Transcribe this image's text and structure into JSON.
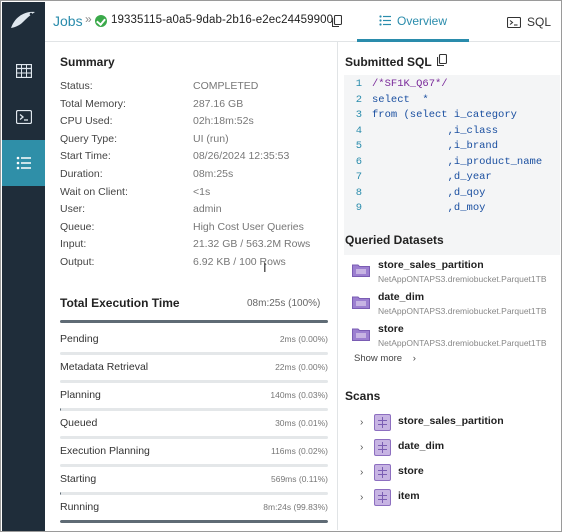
{
  "header": {
    "breadcrumb": "Jobs",
    "separator": "»",
    "job_id": "19335115-a0a5-9dab-2b16-e2ec24459900",
    "tabs": [
      {
        "label": "Overview",
        "icon": "list-icon",
        "active": true
      },
      {
        "label": "SQL",
        "icon": "terminal-icon",
        "active": false
      }
    ],
    "accent_color": "#2a8cac"
  },
  "nav": {
    "items": [
      {
        "icon": "table-icon",
        "active": false
      },
      {
        "icon": "terminal-icon",
        "active": false
      },
      {
        "icon": "list-icon",
        "active": true
      }
    ]
  },
  "summary": {
    "title": "Summary",
    "rows": [
      {
        "key": "Status:",
        "value": "COMPLETED"
      },
      {
        "key": "Total Memory:",
        "value": "287.16 GB"
      },
      {
        "key": "CPU Used:",
        "value": "02h:18m:52s"
      },
      {
        "key": "Query Type:",
        "value": "UI (run)"
      },
      {
        "key": "Start Time:",
        "value": "08/26/2024 12:35:53"
      },
      {
        "key": "Duration:",
        "value": "08m:25s"
      },
      {
        "key": "Wait on Client:",
        "value": "<1s"
      },
      {
        "key": "User:",
        "value": "admin"
      },
      {
        "key": "Queue:",
        "value": "High Cost User Queries"
      },
      {
        "key": "Input:",
        "value": "21.32 GB / 563.2M Rows"
      },
      {
        "key": "Output:",
        "value": "6.92 KB / 100 Rows"
      }
    ]
  },
  "execution": {
    "title": "Total Execution Time",
    "total": "08m:25s (100%)",
    "phases": [
      {
        "label": "Pending",
        "value": "2ms (0.00%)",
        "fraction": 0.0
      },
      {
        "label": "Metadata Retrieval",
        "value": "22ms (0.00%)",
        "fraction": 0.0
      },
      {
        "label": "Planning",
        "value": "140ms (0.03%)",
        "fraction": 0.0003
      },
      {
        "label": "Queued",
        "value": "30ms (0.01%)",
        "fraction": 0.0001
      },
      {
        "label": "Execution Planning",
        "value": "116ms (0.02%)",
        "fraction": 0.0002
      },
      {
        "label": "Starting",
        "value": "569ms (0.11%)",
        "fraction": 0.0011
      },
      {
        "label": "Running",
        "value": "8m:24s (99.83%)",
        "fraction": 0.9983
      }
    ]
  },
  "sql": {
    "title": "Submitted SQL",
    "lines": [
      {
        "num": "1",
        "text": "/*SF1K_Q67*/"
      },
      {
        "num": "2",
        "text": "select  *"
      },
      {
        "num": "3",
        "text": "from (select i_category"
      },
      {
        "num": "4",
        "text": "            ,i_class"
      },
      {
        "num": "5",
        "text": "            ,i_brand"
      },
      {
        "num": "6",
        "text": "            ,i_product_name"
      },
      {
        "num": "7",
        "text": "            ,d_year"
      },
      {
        "num": "8",
        "text": "            ,d_qoy"
      },
      {
        "num": "9",
        "text": "            ,d_moy"
      }
    ]
  },
  "datasets": {
    "title": "Queried Datasets",
    "items": [
      {
        "name": "store_sales_partition",
        "path": "NetAppONTAPS3.dremiobucket.Parquet1TB"
      },
      {
        "name": "date_dim",
        "path": "NetAppONTAPS3.dremiobucket.Parquet1TB"
      },
      {
        "name": "store",
        "path": "NetAppONTAPS3.dremiobucket.Parquet1TB"
      }
    ],
    "show_more": "Show more"
  },
  "scans": {
    "title": "Scans",
    "items": [
      {
        "name": "store_sales_partition"
      },
      {
        "name": "date_dim"
      },
      {
        "name": "store"
      },
      {
        "name": "item"
      }
    ]
  }
}
